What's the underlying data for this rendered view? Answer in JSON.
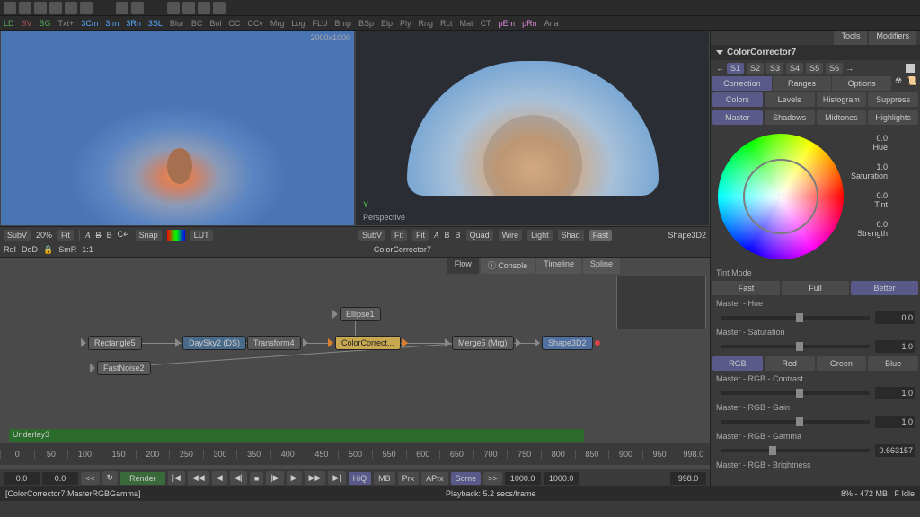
{
  "toolbar_tabs": [
    "LD",
    "SV",
    "BG",
    "Txt+",
    "3Cm",
    "3Im",
    "3Rn",
    "3SL",
    "Blur",
    "BC",
    "Bol",
    "CC",
    "CCv",
    "Mrg",
    "Log",
    "FLU",
    "Bmp",
    "BSp",
    "Elp",
    "Ply",
    "Rng",
    "Rct",
    "Mat",
    "CT",
    "pEm",
    "pRn",
    "Ana"
  ],
  "viewer1": {
    "dims": "2000x1000"
  },
  "viewer2": {
    "axis": "Y",
    "mode": "Perspective"
  },
  "viewer1_footer": {
    "subv": "SubV",
    "zoom": "20%",
    "fit": "Fit",
    "snap": "Snap",
    "lut": "LUT"
  },
  "viewer2_footer": {
    "subv": "SubV",
    "fit1": "Fit",
    "fit2": "Fit",
    "quad": "Quad",
    "wire": "Wire",
    "light": "Light",
    "shad": "Shad",
    "fast": "Fast",
    "tool": "Shape3D2"
  },
  "roi": {
    "roi": "RoI",
    "dod": "DoD",
    "smr": "SmR",
    "ratio": "1:1",
    "tool": "ColorCorrector7"
  },
  "flow_tabs": [
    "Flow",
    "Console",
    "Timeline",
    "Spline"
  ],
  "nodes": {
    "rect": "Rectangle5",
    "daysky": "DaySky2 (DS)",
    "transform": "Transform4",
    "ellipse": "Ellipse1",
    "colorcorrect": "ColorCorrect...",
    "fastnoise": "FastNoise2",
    "merge": "Merge5 (Mrg)",
    "shape3d": "Shape3D2",
    "underlay": "Underlay3"
  },
  "ruler": {
    "ticks": [
      "0",
      "50",
      "100",
      "150",
      "200",
      "250",
      "300",
      "350",
      "400",
      "450",
      "500",
      "550",
      "600",
      "650",
      "700",
      "750",
      "800",
      "850",
      "900",
      "950",
      "998.0"
    ]
  },
  "transport": {
    "start": "0.0",
    "cur": "0.0",
    "render": "Render",
    "hiq": "HiQ",
    "mb": "MB",
    "prx": "Prx",
    "aprx": "APrx",
    "some": "Some",
    "t1": "1000.0",
    "t2": "1000.0",
    "end": "998.0"
  },
  "panel": {
    "title": "ColorCorrector7",
    "states": [
      "S1",
      "S2",
      "S3",
      "S4",
      "S5",
      "S6"
    ],
    "tabs": {
      "correction": "Correction",
      "ranges": "Ranges",
      "options": "Options"
    },
    "modes1": [
      "Colors",
      "Levels",
      "Histogram",
      "Suppress"
    ],
    "modes2": [
      "Master",
      "Shadows",
      "Midtones",
      "Highlights"
    ],
    "wheel": {
      "hue": "0.0",
      "hue_l": "Hue",
      "sat": "1.0",
      "sat_l": "Saturation",
      "tint": "0.0",
      "tint_l": "Tint",
      "str": "0.0",
      "str_l": "Strength"
    },
    "tint_mode": "Tint Mode",
    "tint_opts": [
      "Fast",
      "Full",
      "Better"
    ],
    "params": [
      {
        "label": "Master - Hue",
        "val": "0.0",
        "pos": "50%"
      },
      {
        "label": "Master - Saturation",
        "val": "1.0",
        "pos": "50%"
      }
    ],
    "rgb_tabs": [
      "RGB",
      "Red",
      "Green",
      "Blue"
    ],
    "params2": [
      {
        "label": "Master - RGB - Contrast",
        "val": "1.0",
        "pos": "50%"
      },
      {
        "label": "Master - RGB - Gain",
        "val": "1.0",
        "pos": "50%"
      },
      {
        "label": "Master - RGB - Gamma",
        "val": "0.663157",
        "pos": "32%"
      },
      {
        "label": "Master - RGB - Brightness",
        "val": "",
        "pos": "50%"
      }
    ],
    "side_tabs": {
      "tools": "Tools",
      "modifiers": "Modifiers"
    }
  },
  "status": {
    "left": "[ColorCorrector7.MasterRGBGamma]",
    "center": "Playback: 5.2 secs/frame",
    "mem": "8% - 472 MB",
    "idle": "F Idle"
  }
}
